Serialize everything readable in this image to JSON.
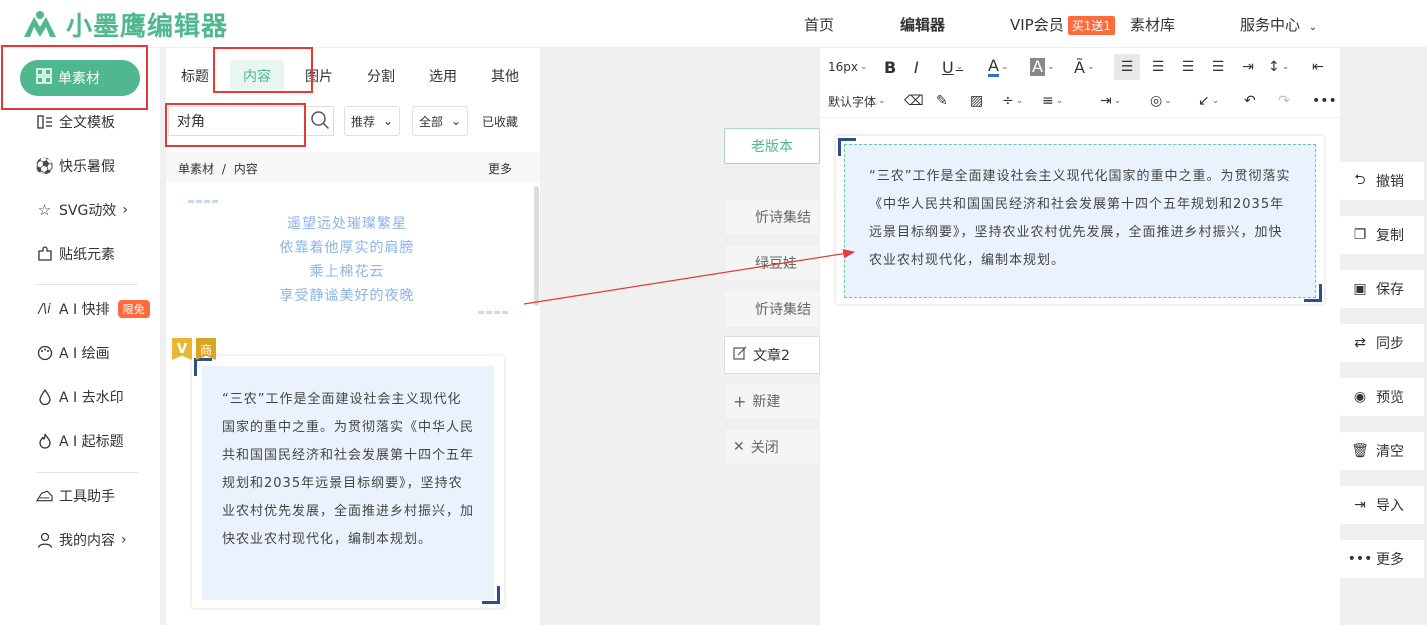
{
  "brand": {
    "name": "小墨鹰编辑器",
    "color": "#4fb88f"
  },
  "topnav": {
    "home": "首页",
    "editor": "编辑器",
    "vip": "VIP会员",
    "vip_badge": "买1送1",
    "library": "素材库",
    "service": "服务中心"
  },
  "sidebar": {
    "items": [
      {
        "label": "单素材",
        "icon": "grid-icon"
      },
      {
        "label": "全文模板",
        "icon": "template-icon"
      },
      {
        "label": "快乐暑假",
        "icon": "ball-icon"
      },
      {
        "label": "SVG动效",
        "icon": "star-icon"
      },
      {
        "label": "贴纸元素",
        "icon": "puzzle-icon"
      },
      {
        "label": "A I 快排",
        "icon": "ai-icon",
        "badge": "限免"
      },
      {
        "label": "A I 绘画",
        "icon": "palette-icon"
      },
      {
        "label": "A I 去水印",
        "icon": "drop-icon"
      },
      {
        "label": "A I 起标题",
        "icon": "fire-icon"
      },
      {
        "label": "工具助手",
        "icon": "tools-icon"
      },
      {
        "label": "我的内容",
        "icon": "user-icon"
      }
    ]
  },
  "panel": {
    "tabs": [
      "标题",
      "内容",
      "图片",
      "分割",
      "选用",
      "其他"
    ],
    "active_tab": "内容",
    "search": {
      "value": "对角",
      "placeholder": ""
    },
    "sort": "推荐",
    "filter": "全部",
    "favorites": "已收藏",
    "breadcrumb": {
      "root": "单素材",
      "sep": "/",
      "current": "内容"
    },
    "more": "更多",
    "card1_lines": [
      "遥望远处璀璨繁星",
      "依靠着他厚实的肩膀",
      "乘上棉花云",
      "享受静谧美好的夜晚"
    ],
    "card2_badges": {
      "v": "V",
      "s": "商"
    },
    "card2_text": "“三农”工作是全面建设社会主义现代化国家的重中之重。为贯彻落实《中华人民共和国国民经济和社会发展第十四个五年规划和2035年远景目标纲要》，坚持农业农村优先发展，全面推进乡村振兴，加快农业农村现代化，编制本规划。"
  },
  "articles": {
    "old_version": "老版本",
    "items": [
      "忻诗集结",
      "绿豆娃",
      "忻诗集结"
    ],
    "current": "文章2",
    "new": "新建",
    "close": "关闭"
  },
  "editor": {
    "font_size": "16px",
    "font_family": "默认字体",
    "content": "“三农”工作是全面建设社会主义现代化国家的重中之重。为贯彻落实《中华人民共和国国民经济和社会发展第十四个五年规划和2035年远景目标纲要》，坚持农业农村优先发展，全面推进乡村振兴，加快农业农村现代化，编制本规划。"
  },
  "actions": [
    "撤销",
    "复制",
    "保存",
    "同步",
    "预览",
    "清空",
    "导入",
    "更多"
  ]
}
